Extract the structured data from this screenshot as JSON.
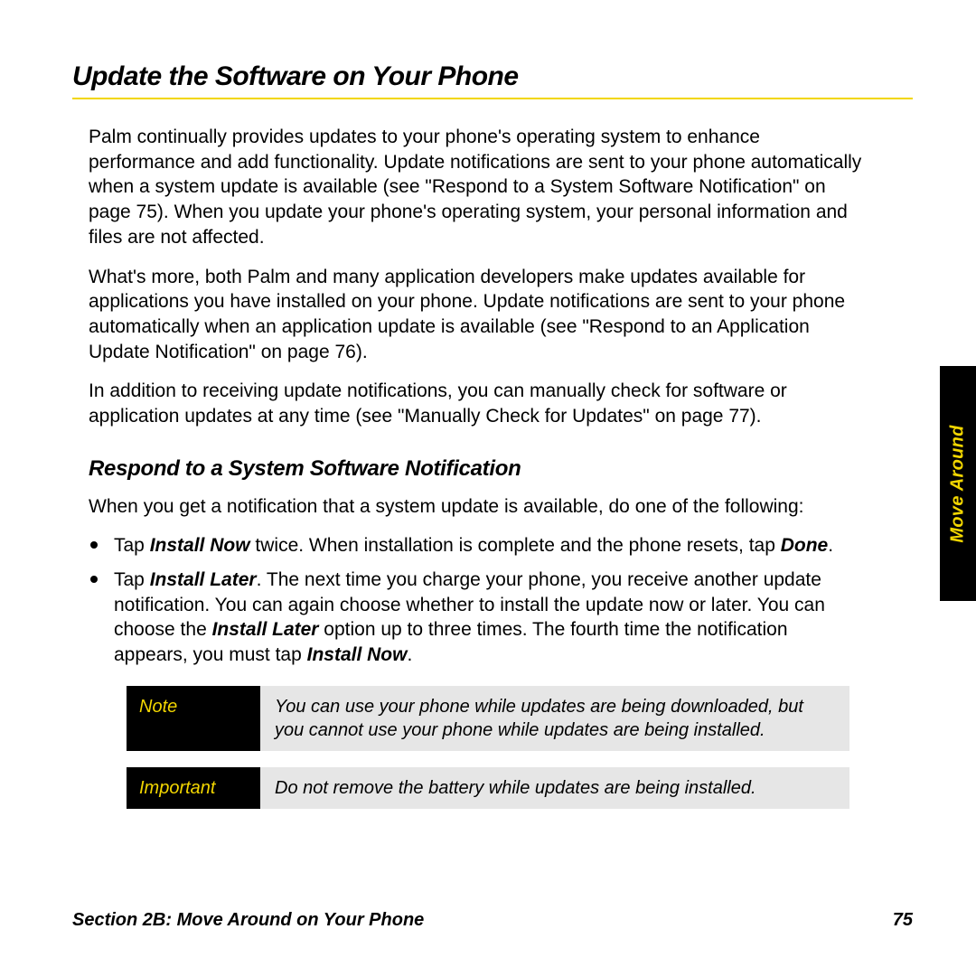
{
  "title": "Update the Software on Your Phone",
  "intro_p1": "Palm continually provides updates to your phone's operating system to enhance performance and add functionality. Update notifications are sent to your phone automatically when a system update is available (see \"Respond to a System Software Notification\" on page 75). When you update your phone's operating system, your personal information and files are not affected.",
  "intro_p2": "What's more, both Palm and many application developers make updates available for applications you have installed on your phone. Update notifications are sent to your phone automatically when an application update is available (see \"Respond to an Application Update Notification\" on page 76).",
  "intro_p3": "In addition to receiving update notifications, you can manually check for software or application updates at any time (see \"Manually Check for Updates\" on page 77).",
  "subhead": "Respond to a System Software Notification",
  "sub_intro": "When you get a notification that a system update is available, do one of the following:",
  "bullets": {
    "b1": {
      "pre": "Tap ",
      "bi1": "Install Now",
      "mid": " twice. When installation is complete and the phone resets, tap ",
      "bi2": "Done",
      "post": "."
    },
    "b2": {
      "pre": "Tap ",
      "bi1": "Install Later",
      "mid": ". The next time you charge your phone, you receive another update notification. You can again choose whether to install the update now or later. You can choose the ",
      "bi2": "Install Later",
      "mid2": " option up to three times. The fourth time the notification appears, you must tap ",
      "bi3": "Install Now",
      "post": "."
    }
  },
  "note": {
    "label": "Note",
    "text": "You can use your phone while updates are being downloaded, but you cannot use your phone while updates are being installed."
  },
  "important": {
    "label": "Important",
    "text": "Do not remove the battery while updates are being installed."
  },
  "sidetab": "Move Around",
  "footer": {
    "section": "Section 2B: Move Around on Your Phone",
    "page": "75"
  }
}
